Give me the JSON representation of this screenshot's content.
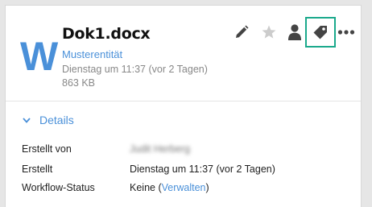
{
  "file": {
    "icon_letter": "W",
    "name": "Dok1.docx",
    "entity": "Musterentität",
    "modified": "Dienstag um 11:37 (vor 2 Tagen)",
    "size": "863 KB"
  },
  "actions": [
    {
      "name": "edit-icon"
    },
    {
      "name": "star-icon"
    },
    {
      "name": "user-icon"
    },
    {
      "name": "tag-icon",
      "highlighted": true
    },
    {
      "name": "more-icon"
    }
  ],
  "details": {
    "toggle_label": "Details",
    "rows": [
      {
        "key": "Erstellt von",
        "value": "Judit Herberg"
      },
      {
        "key": "Erstellt",
        "value": "Dienstag um 11:37 (vor 2 Tagen)"
      },
      {
        "key": "Workflow-Status",
        "value_prefix": "Keine (",
        "value_link": "Verwalten",
        "value_suffix": ")"
      }
    ]
  },
  "colors": {
    "accent": "#4a90d9",
    "highlight_border": "#1ba98c",
    "icon_dark": "#444444",
    "icon_light": "#cccccc"
  }
}
